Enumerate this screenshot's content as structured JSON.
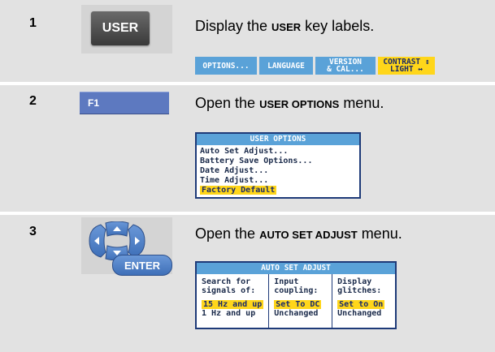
{
  "steps": [
    {
      "number": "1",
      "key_label": "USER",
      "title_pre": "Display the ",
      "title_bold": "USER",
      "title_post": " key labels."
    },
    {
      "number": "2",
      "key_label": "F1",
      "title_pre": "Open the ",
      "title_bold": "USER OPTIONS",
      "title_post": " menu."
    },
    {
      "number": "3",
      "key_label": "ENTER",
      "title_pre": "Open the ",
      "title_bold": "AUTO SET ADJUST",
      "title_post": " menu."
    }
  ],
  "softkeys": [
    {
      "label": "OPTIONS...",
      "active": false
    },
    {
      "label": "LANGUAGE",
      "active": false
    },
    {
      "label": "VERSION\n& CAL...",
      "active": false
    },
    {
      "label": "CONTRAST ↕\nLIGHT ↔",
      "active": true
    }
  ],
  "user_options_menu": {
    "title": "USER OPTIONS",
    "items": [
      "Auto Set Adjust...",
      "Battery Save Options...",
      "Date Adjust...",
      "Time Adjust...",
      "Factory Default"
    ],
    "selected_index": 4
  },
  "auto_set_menu": {
    "title": "AUTO SET ADJUST",
    "columns": [
      {
        "header": "Search for\nsignals of:",
        "options": [
          "15 Hz and up",
          "1 Hz and up"
        ],
        "selected_index": 0
      },
      {
        "header": "Input\ncoupling:",
        "options": [
          "Set To DC",
          "Unchanged"
        ],
        "selected_index": 0
      },
      {
        "header": "Display\nglitches:",
        "options": [
          "Set to On",
          "Unchanged"
        ],
        "selected_index": 0
      }
    ]
  },
  "colors": {
    "softkey_blue": "#5aa2d8",
    "highlight_yellow": "#ffd61a",
    "panel_navy": "#1e3a78",
    "row_gray": "#e2e2e2"
  }
}
